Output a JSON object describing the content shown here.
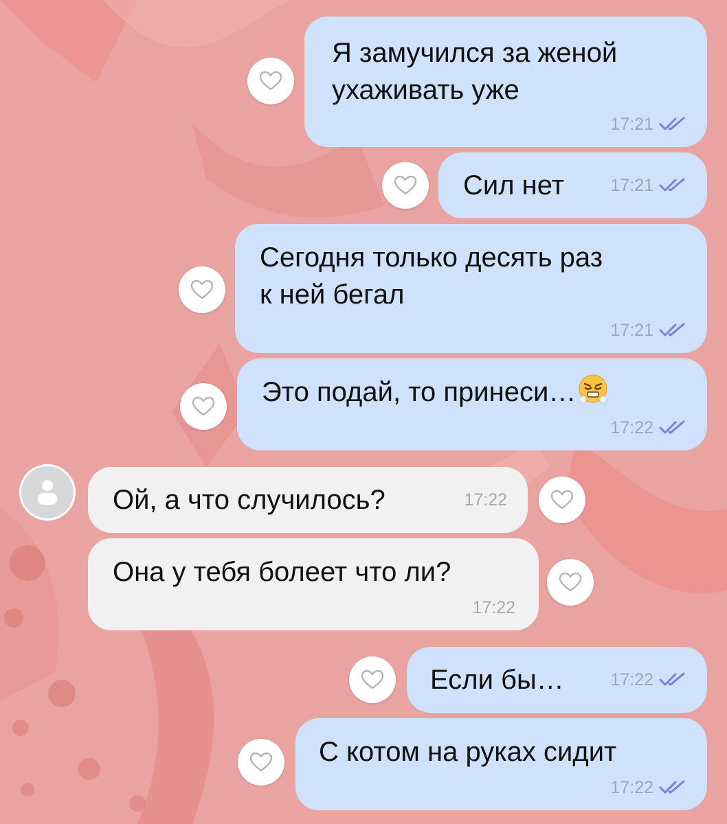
{
  "colors": {
    "background": "#e9a3a1",
    "outgoing_bubble": "#cfe1fb",
    "incoming_bubble": "#f1f1f2",
    "read_ticks": "#7b7fdc"
  },
  "messages": [
    {
      "direction": "out",
      "text": "Я замучился за женой\nухаживать уже",
      "time": "17:21",
      "status": "read-ticks-icon"
    },
    {
      "direction": "out",
      "text": "Сил нет",
      "time": "17:21",
      "status": "read-ticks-icon"
    },
    {
      "direction": "out",
      "text": "Сегодня только десять раз\nк ней бегал",
      "time": "17:21",
      "status": "read-ticks-icon"
    },
    {
      "direction": "out",
      "text": "Это подай, то принеси…",
      "emoji": "face-with-steam-emoji",
      "time": "17:22",
      "status": "read-ticks-icon"
    },
    {
      "direction": "in",
      "text": "Ой, а что случилось?",
      "time": "17:22"
    },
    {
      "direction": "in",
      "text": "Она у тебя болеет что ли?",
      "time": "17:22"
    },
    {
      "direction": "out",
      "text": "Если бы…",
      "time": "17:22",
      "status": "read-ticks-icon"
    },
    {
      "direction": "out",
      "text": "С котом на руках сидит",
      "time": "17:22",
      "status": "read-ticks-icon"
    }
  ],
  "icons": {
    "reaction": "heart-outline-icon",
    "avatar": "person-placeholder-icon"
  }
}
